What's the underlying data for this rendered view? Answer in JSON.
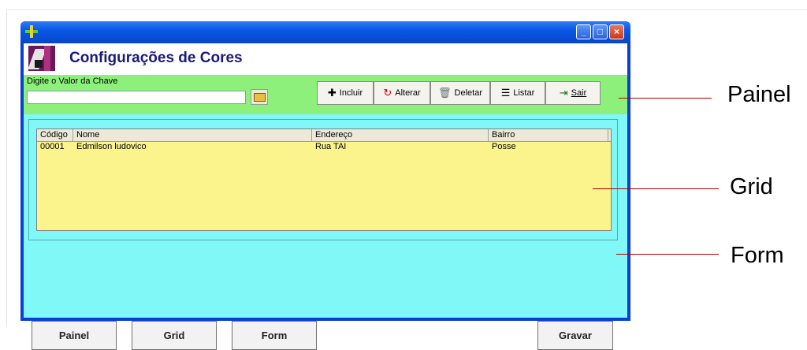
{
  "header": {
    "title": "Configurações de Cores"
  },
  "panel": {
    "key_label": "Digite o Valor da Chave",
    "key_value": "",
    "toolbar": [
      {
        "label": "Incluir",
        "icon": "plus-icon"
      },
      {
        "label": "Alterar",
        "icon": "refresh-icon"
      },
      {
        "label": "Deletar",
        "icon": "trash-icon"
      },
      {
        "label": "Listar",
        "icon": "list-icon"
      },
      {
        "label": "Sair",
        "icon": "exit-door-icon"
      }
    ]
  },
  "grid": {
    "columns": [
      "Código",
      "Nome",
      "Endereço",
      "Bairro"
    ],
    "rows": [
      {
        "codigo": "00001",
        "nome": "Edmilson ludovico",
        "endereco": "Rua TAI",
        "bairro": "Posse"
      }
    ]
  },
  "buttons": {
    "painel": "Painel",
    "grid": "Grid",
    "form": "Form",
    "gravar": "Gravar"
  },
  "annotations": {
    "painel": "Painel",
    "grid": "Grid",
    "form": "Form"
  },
  "colors": {
    "panel": "#8cf07a",
    "form": "#80f8f8",
    "grid": "#fbf38c",
    "titlebar": "#0a58e6"
  }
}
